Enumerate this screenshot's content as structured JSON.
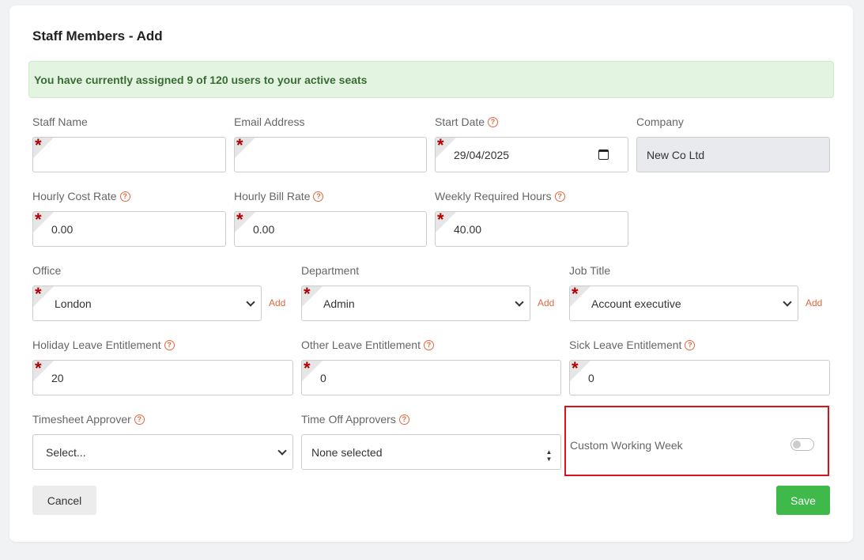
{
  "page": {
    "title": "Staff Members - Add"
  },
  "alert": {
    "text": "You have currently assigned 9 of 120 users to your active seats"
  },
  "fields": {
    "staff_name": {
      "label": "Staff Name",
      "value": ""
    },
    "email": {
      "label": "Email Address",
      "value": ""
    },
    "start_date": {
      "label": "Start Date",
      "value": "29/04/2025"
    },
    "company": {
      "label": "Company",
      "value": "New Co Ltd"
    },
    "hourly_cost": {
      "label": "Hourly Cost Rate",
      "value": "0.00"
    },
    "hourly_bill": {
      "label": "Hourly Bill Rate",
      "value": "0.00"
    },
    "weekly_hours": {
      "label": "Weekly Required Hours",
      "value": "40.00"
    },
    "office": {
      "label": "Office",
      "value": "London",
      "add": "Add"
    },
    "department": {
      "label": "Department",
      "value": "Admin",
      "add": "Add"
    },
    "job_title": {
      "label": "Job Title",
      "value": "Account executive",
      "add": "Add"
    },
    "holiday_leave": {
      "label": "Holiday Leave Entitlement",
      "value": "20"
    },
    "other_leave": {
      "label": "Other Leave Entitlement",
      "value": "0"
    },
    "sick_leave": {
      "label": "Sick Leave Entitlement",
      "value": "0"
    },
    "timesheet_approver": {
      "label": "Timesheet Approver",
      "value": "Select..."
    },
    "time_off_approvers": {
      "label": "Time Off Approvers",
      "value": "None selected"
    }
  },
  "custom_week": {
    "label": "Custom Working Week",
    "enabled": false
  },
  "buttons": {
    "cancel": "Cancel",
    "save": "Save"
  },
  "icons": {
    "help": "?",
    "required": "*",
    "updown": "▲▼"
  },
  "colors": {
    "accent": "#e0683f",
    "save": "#3fb949",
    "alert_bg": "#e3f5e1",
    "highlight": "#d7141a"
  }
}
